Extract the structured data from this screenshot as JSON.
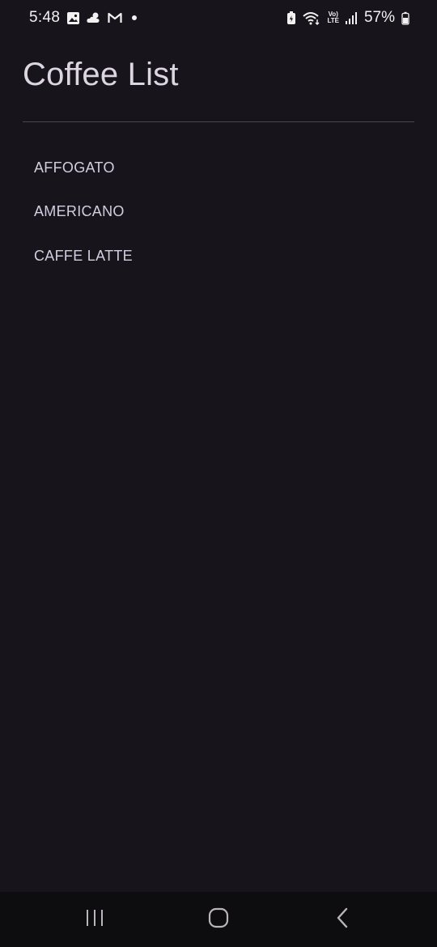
{
  "status_bar": {
    "time": "5:48",
    "battery_percent": "57%",
    "volte_top": "Vo)",
    "volte_bottom": "LTE",
    "icons": [
      "gallery-icon",
      "weather-icon",
      "gmail-icon",
      "notification-dot",
      "battery-saver-icon",
      "wifi-icon",
      "volte-icon",
      "signal-icon",
      "battery-icon"
    ]
  },
  "header": {
    "title": "Coffee List"
  },
  "coffee_list": {
    "items": [
      {
        "label": "AFFOGATO"
      },
      {
        "label": "AMERICANO"
      },
      {
        "label": "CAFFE LATTE"
      }
    ]
  },
  "nav_bar": {
    "buttons": [
      "recent-apps-icon",
      "home-icon",
      "back-icon"
    ]
  },
  "colors": {
    "background": "#17141b",
    "title": "#ddd6e2",
    "list_text": "#d4cde0",
    "nav_background": "#0d0c0e"
  }
}
